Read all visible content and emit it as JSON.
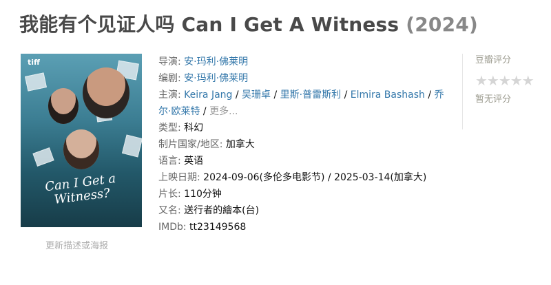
{
  "title": {
    "main": "我能有个见证人吗 Can I Get A Witness",
    "year": "(2024)"
  },
  "poster": {
    "badge": "tiff",
    "title_text": "Can I Get a Witness?"
  },
  "update_link": "更新描述或海报",
  "info": {
    "director": {
      "label": "导演: ",
      "names": [
        "安·玛利·佛莱明"
      ]
    },
    "writer": {
      "label": "编剧: ",
      "names": [
        "安·玛利·佛莱明"
      ]
    },
    "cast": {
      "label": "主演: ",
      "names": [
        "Keira Jang",
        "吴珊卓",
        "里斯·普雷斯利",
        "Elmira Bashash",
        "乔尔·欧莱特"
      ],
      "more": "更多..."
    },
    "genre": {
      "label": "类型: ",
      "value": "科幻"
    },
    "country": {
      "label": "制片国家/地区: ",
      "value": "加拿大"
    },
    "language": {
      "label": "语言: ",
      "value": "英语"
    },
    "release": {
      "label": "上映日期: ",
      "value": "2024-09-06(多伦多电影节) / 2025-03-14(加拿大)"
    },
    "runtime": {
      "label": "片长: ",
      "value": "110分钟"
    },
    "aka": {
      "label": "又名: ",
      "value": "送行者的繪本(台)"
    },
    "imdb": {
      "label": "IMDb: ",
      "value": "tt23149568"
    }
  },
  "rating": {
    "label": "豆瓣评分",
    "stars": "★★★★★",
    "no_rating": "暂无评分",
    "star_color": "#d5d5d5"
  }
}
